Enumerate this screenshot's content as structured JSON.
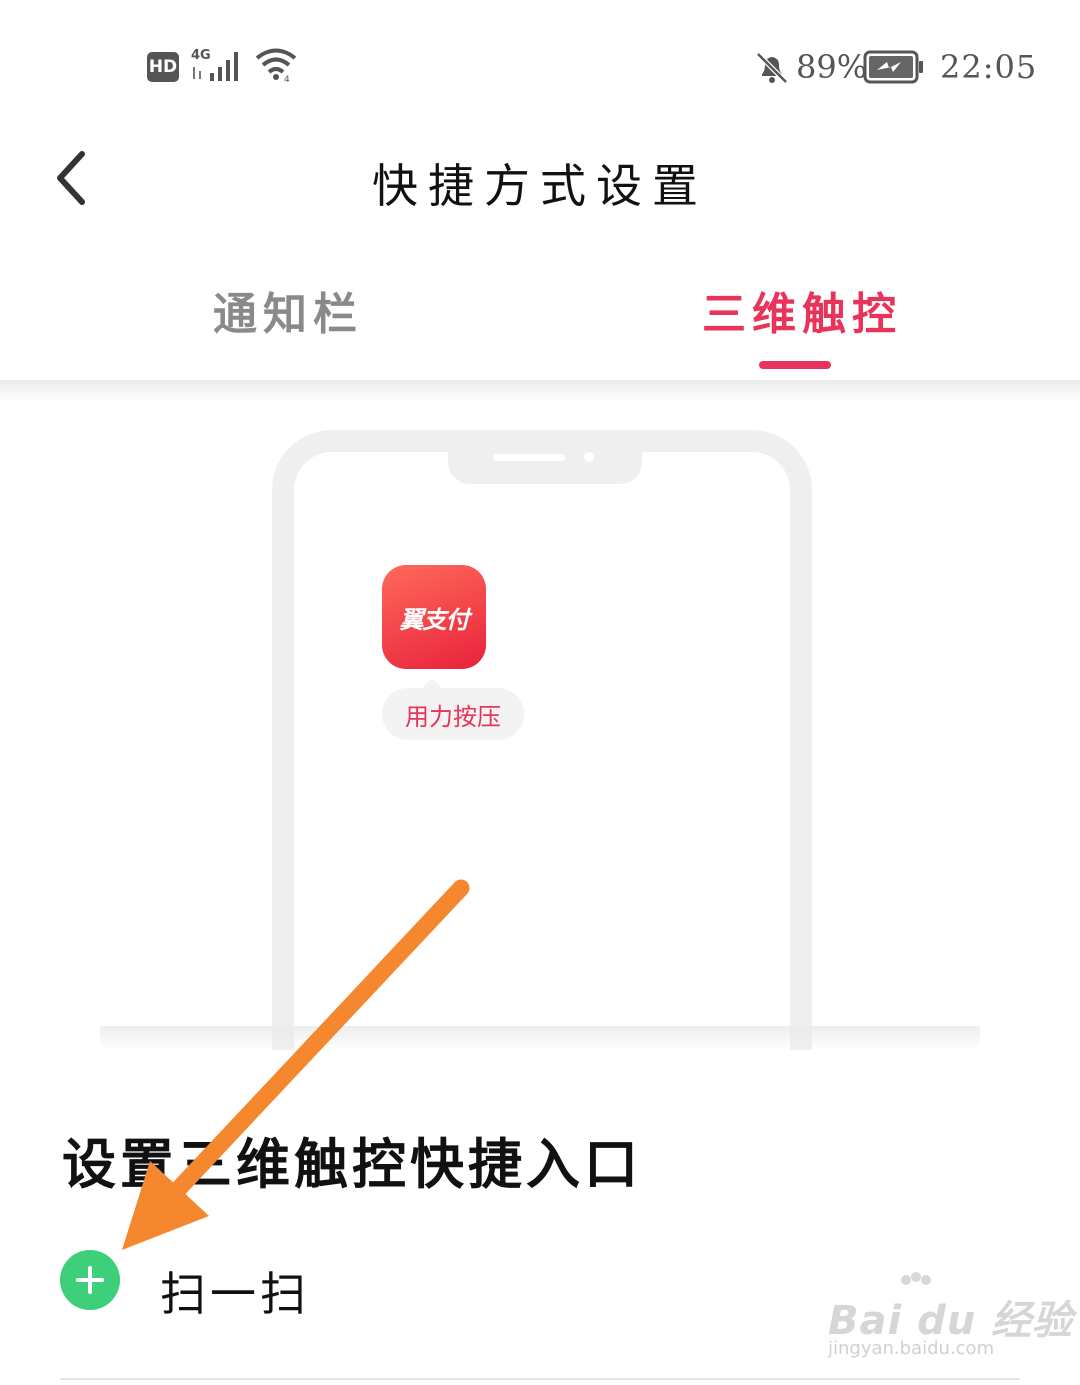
{
  "status_bar": {
    "hd": "HD",
    "network": "4G",
    "battery_percent": "89%",
    "time": "22:05",
    "icons": [
      "signal-icon",
      "wifi-icon",
      "mute-bell-icon",
      "battery-charging-icon"
    ]
  },
  "header": {
    "title": "快捷方式设置",
    "back_icon": "chevron-left-icon"
  },
  "tabs": [
    {
      "label": "通知栏",
      "active": false
    },
    {
      "label": "三维触控",
      "active": true
    }
  ],
  "preview": {
    "app_icon_text": "翼支付",
    "press_hint": "用力按压"
  },
  "section": {
    "title": "设置三维触控快捷入口",
    "items": [
      {
        "label": "扫一扫",
        "action_icon": "add-circle-icon"
      }
    ]
  },
  "watermark": {
    "logo": "Bai du 经验",
    "url": "jingyan.baidu.com"
  },
  "colors": {
    "accent": "#e8335a",
    "add_button": "#3ecf7a",
    "annotation_arrow": "#f5872e",
    "inactive_tab": "#8a8a8a"
  }
}
